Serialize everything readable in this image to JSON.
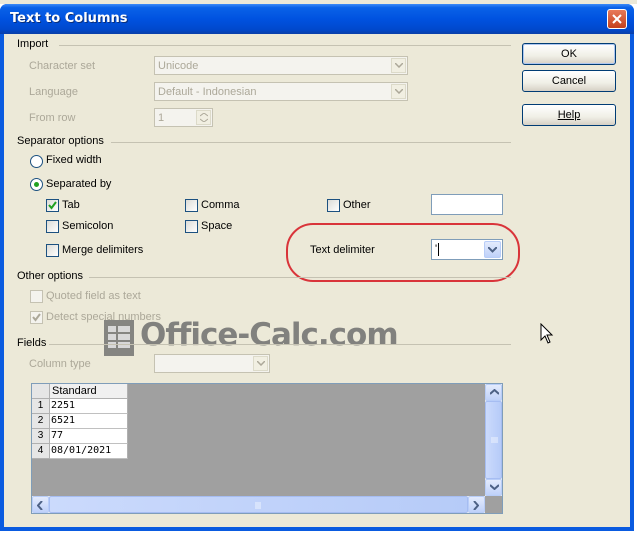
{
  "window": {
    "title": "Text to Columns"
  },
  "import": {
    "section_label": "Import",
    "charset_label": "Character set",
    "charset_value": "Unicode",
    "language_label": "Language",
    "language_value": "Default - Indonesian",
    "from_row_label": "From row",
    "from_row_value": "1"
  },
  "separator": {
    "section_label": "Separator options",
    "fixed_width_label": "Fixed width",
    "separated_by_label": "Separated by",
    "selected_mode": "separated_by",
    "tab_label": "Tab",
    "tab_checked": true,
    "comma_label": "Comma",
    "comma_checked": false,
    "other_label": "Other",
    "other_checked": false,
    "other_value": "",
    "semicolon_label": "Semicolon",
    "semicolon_checked": false,
    "space_label": "Space",
    "space_checked": false,
    "merge_label": "Merge delimiters",
    "merge_checked": false,
    "text_delimiter_label": "Text delimiter",
    "text_delimiter_value": "'"
  },
  "other_options": {
    "section_label": "Other options",
    "quoted_label": "Quoted field as text",
    "quoted_checked": false,
    "detect_label": "Detect special numbers",
    "detect_checked": true
  },
  "fields": {
    "section_label": "Fields",
    "column_type_label": "Column type",
    "column_type_value": ""
  },
  "preview": {
    "column_header": "Standard",
    "rows": [
      {
        "num": "1",
        "value": "2251"
      },
      {
        "num": "2",
        "value": "6521"
      },
      {
        "num": "3",
        "value": "77"
      },
      {
        "num": "4",
        "value": "08/01/2021"
      }
    ]
  },
  "buttons": {
    "ok": "OK",
    "cancel": "Cancel",
    "help": "Help"
  },
  "watermark": {
    "text": "Office-Calc.com"
  },
  "colors": {
    "highlight_ring": "#d9343a",
    "title_bar": "#0052e0",
    "dialog_bg": "#ece9d8"
  }
}
